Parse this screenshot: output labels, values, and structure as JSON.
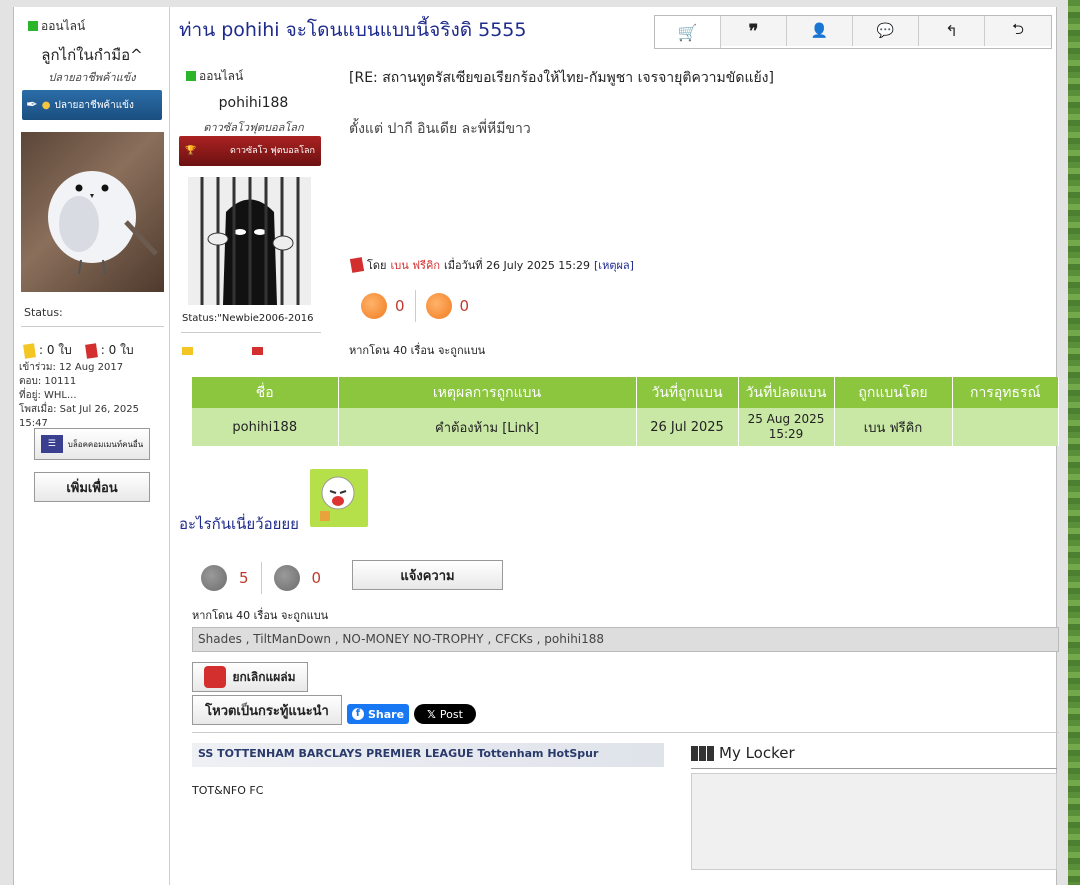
{
  "sidebar": {
    "status_online": "ออนไลน์",
    "display_name": "ลูกไก่ในกำมือ^",
    "user_title": "ปลายอาชีพค้าแข้ง",
    "badge_label": "ปลายอาชีพค้าแข้ง",
    "status_label": "Status:",
    "yellow_cards": ": 0 ใบ",
    "red_cards": ": 0 ใบ",
    "joined": "เข้าร่วม: 12 Aug 2017",
    "replies": "ตอบ: 10111",
    "location": "ที่อยู่: WHL...",
    "last_post": "โพสเมื่อ: Sat Jul 26, 2025 15:47",
    "blog_button": "บล็อคคอมเมนท์คนอื่น",
    "add_friend_button": "เพิ่มเพื่อน"
  },
  "post": {
    "title": "ท่าน pohihi จะโดนแบนแบบนี้จริงดิ 5555",
    "quoted": {
      "status_online": "ออนไลน์",
      "username": "pohihi188",
      "user_title": "ดาวซัลโวฟุตบอลโลก",
      "badge_label": "ดาวซัลโว ฟุตบอลโลก",
      "status": "Status:\"Newbie2006-2016",
      "subject": "[RE: สถานทูตรัสเซียขอเรียกร้องให้ไทย-กัมพูชา เจรจายุติความขัดแย้ง]",
      "message": "ตั้งแต่ ปากี อินเดีย ละพี่หีมีขาว",
      "ban_prefix": "โดย",
      "ban_by": "เบน ฟรีคิก",
      "ban_date": "เมื่อวันที่ 26 July 2025 15:29",
      "ban_reason_link": "[เหตุผล]",
      "like_count": "0",
      "dislike_count": "0",
      "ban_note": "หากโดน 40 เรื่อน จะถูกแบน"
    },
    "ban_table": {
      "headers": [
        "ชื่อ",
        "เหตุผลการถูกแบน",
        "วันที่ถูกแบน",
        "วันที่ปลดแบน",
        "ถูกแบนโดย",
        "การอุทธรณ์"
      ],
      "row": [
        "pohihi188",
        "คำต้องห้าม [Link]",
        "26 Jul 2025",
        "25 Aug 2025 15:29",
        "เบน ฟรีคิก",
        ""
      ]
    },
    "reply_text": "อะไรกันเนี่ยว้อยยย",
    "like_count": "5",
    "dislike_count": "0",
    "report_button": "แจ้งความ",
    "ban_note": "หากโดน 40 เรื่อน จะถูกแบน",
    "likers": "Shades , TiltManDown , NO-MONEY NO-TROPHY , CFCKs , pohihi188",
    "unhide_button": "ยกเลิกแผล่ม",
    "vote_button": "โหวตเป็นกระทู้แนะนำ",
    "share_button": "Share",
    "post_button": "Post",
    "signature_banner": "SS  TOTTENHAM  BARCLAYS PREMIER LEAGUE  Tottenham HotSpur",
    "signature_text": "TOT&NFO FC",
    "locker_title": "My Locker"
  },
  "colors": {
    "title_blue": "#1f2b8c",
    "table_header": "#8cc63f",
    "table_row": "#c9e7a5",
    "online_green": "#2bb52b",
    "ban_red": "#d32f2f"
  }
}
